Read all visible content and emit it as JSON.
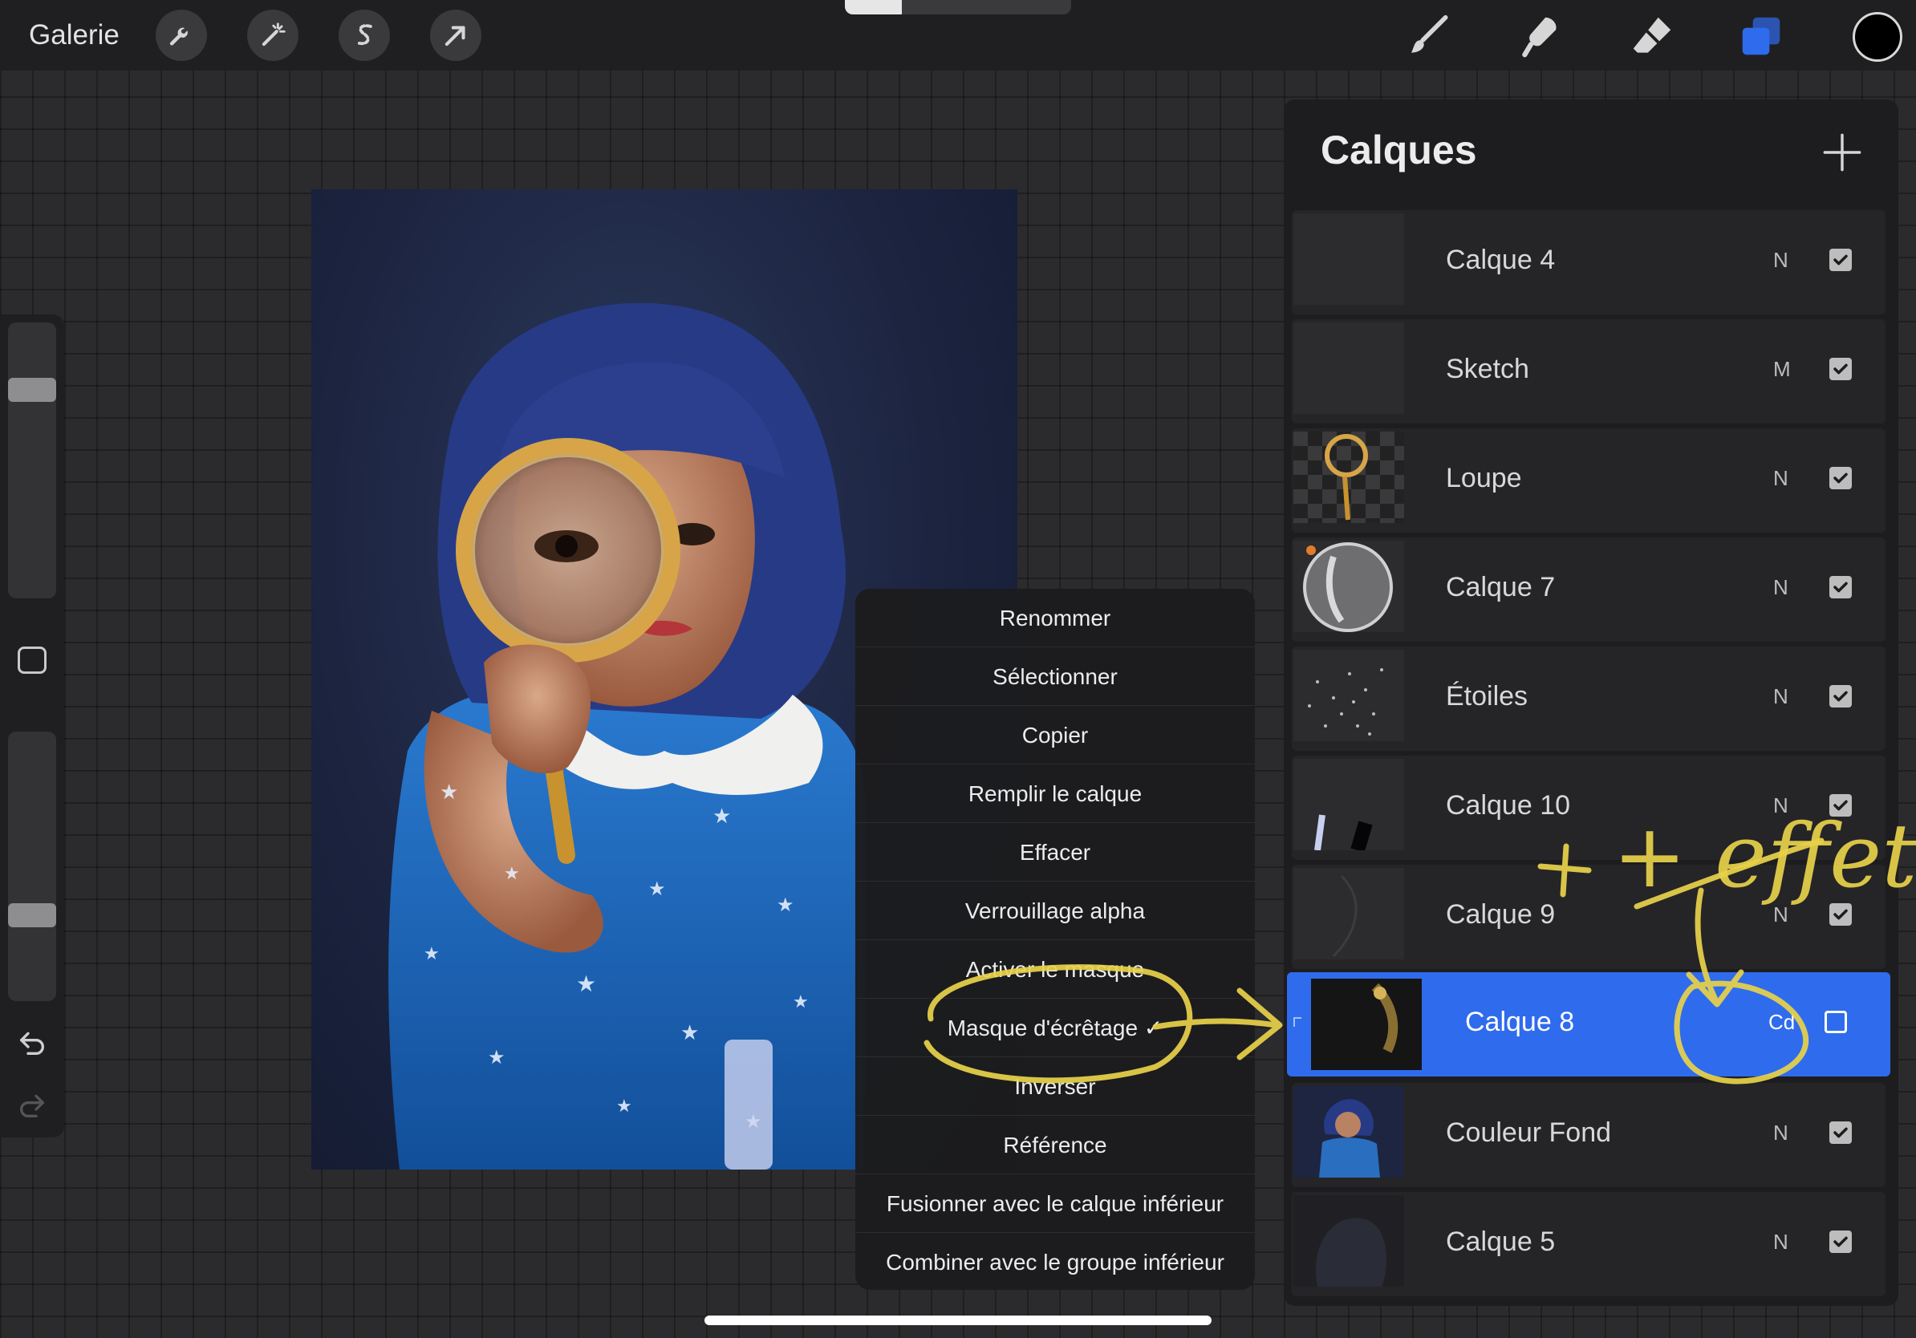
{
  "topbar": {
    "gallery_label": "Galerie",
    "left_tools": [
      "wrench-icon",
      "magic-wand-icon",
      "selection-icon",
      "transform-arrow-icon"
    ],
    "right_tools": [
      "brush-icon",
      "smudge-icon",
      "eraser-icon",
      "layers-icon"
    ],
    "brush_size_fraction": 0.25,
    "active_color": "#000000"
  },
  "sidebar": {
    "size_slider_value": 0.78,
    "opacity_slider_value": 0.3
  },
  "context_menu": {
    "items": [
      "Renommer",
      "Sélectionner",
      "Copier",
      "Remplir le calque",
      "Effacer",
      "Verrouillage alpha",
      "Activer le masque",
      "Masque d'écrêtage ✓",
      "Inverser",
      "Référence",
      "Fusionner avec le calque inférieur",
      "Combiner avec le groupe inférieur"
    ]
  },
  "layers": {
    "title": "Calques",
    "items": [
      {
        "name": "Calque 4",
        "mode": "N",
        "visible": true
      },
      {
        "name": "Sketch",
        "mode": "M",
        "visible": true
      },
      {
        "name": "Loupe",
        "mode": "N",
        "visible": true
      },
      {
        "name": "Calque 7",
        "mode": "N",
        "visible": true
      },
      {
        "name": "Étoiles",
        "mode": "N",
        "visible": true
      },
      {
        "name": "Calque 10",
        "mode": "N",
        "visible": true
      },
      {
        "name": "Calque 9",
        "mode": "N",
        "visible": true
      },
      {
        "name": "Calque 8",
        "mode": "Cd",
        "visible": false,
        "selected": true,
        "clipped": true
      },
      {
        "name": "Couleur Fond",
        "mode": "N",
        "visible": true
      },
      {
        "name": "Calque 5",
        "mode": "N",
        "visible": true
      }
    ]
  },
  "annotation": {
    "handwritten": "+ effet",
    "color": "#e8d24a"
  },
  "colors": {
    "accent": "#2f6bed",
    "panel": "#1d1d1f",
    "toolbar": "#1f1f21"
  }
}
